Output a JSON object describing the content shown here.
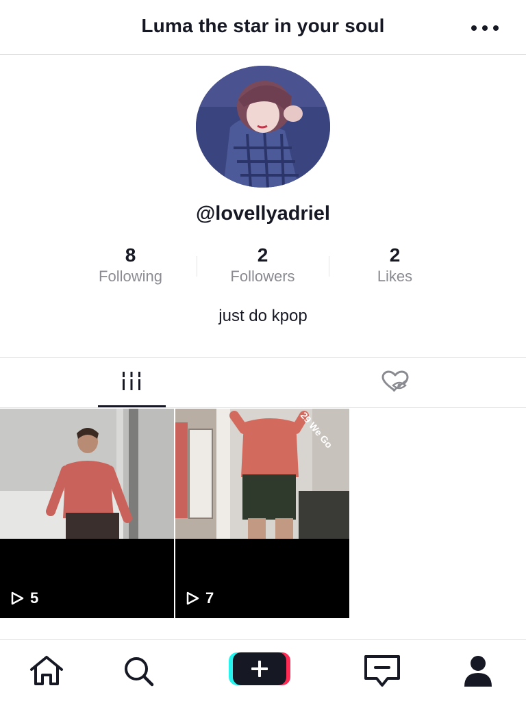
{
  "header": {
    "title": "Luma the star in your soul",
    "more_icon": "more-horizontal-icon"
  },
  "profile": {
    "username": "@lovellyadriel",
    "bio": "just do kpop",
    "stats": [
      {
        "value": "8",
        "label": "Following"
      },
      {
        "value": "2",
        "label": "Followers"
      },
      {
        "value": "2",
        "label": "Likes"
      }
    ]
  },
  "tabs": [
    {
      "name": "videos",
      "icon": "grid-bars-icon",
      "active": true
    },
    {
      "name": "liked",
      "icon": "hidden-heart-icon",
      "active": false
    }
  ],
  "videos": [
    {
      "plays": "5"
    },
    {
      "plays": "7"
    }
  ],
  "bottom_nav": [
    {
      "name": "home",
      "icon": "home-icon"
    },
    {
      "name": "discover",
      "icon": "search-icon"
    },
    {
      "name": "create",
      "icon": "plus-icon"
    },
    {
      "name": "inbox",
      "icon": "message-icon"
    },
    {
      "name": "me",
      "icon": "profile-icon"
    }
  ],
  "colors": {
    "text": "#161823",
    "secondary_text": "#8a8b91",
    "divider": "#e3e3e4",
    "create_cyan": "#25f4ee",
    "create_pink": "#fe2c55"
  }
}
